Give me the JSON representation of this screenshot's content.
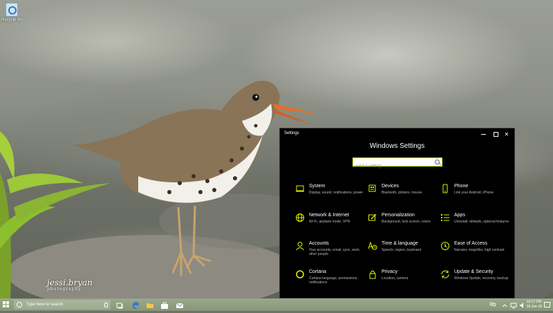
{
  "desktop": {
    "recycle_bin_label": "Recycle Bin",
    "watermark_name": "jessi.bryan",
    "watermark_sub": "photography"
  },
  "window": {
    "title": "Settings",
    "heading": "Windows Settings",
    "search_placeholder": "Find a setting",
    "accent": "#e5f500"
  },
  "tiles": [
    {
      "name": "System",
      "desc": "Display, sound, notifications, power",
      "icon": "laptop-icon"
    },
    {
      "name": "Devices",
      "desc": "Bluetooth, printers, mouse",
      "icon": "keyboard-icon"
    },
    {
      "name": "Phone",
      "desc": "Link your Android, iPhone",
      "icon": "phone-icon"
    },
    {
      "name": "Network & Internet",
      "desc": "Wi-Fi, airplane mode, VPN",
      "icon": "globe-icon"
    },
    {
      "name": "Personalization",
      "desc": "Background, lock screen, colors",
      "icon": "paintbrush-icon"
    },
    {
      "name": "Apps",
      "desc": "Uninstall, defaults, optional features",
      "icon": "apps-list-icon"
    },
    {
      "name": "Accounts",
      "desc": "Your accounts, email, sync, work, other people",
      "icon": "person-icon"
    },
    {
      "name": "Time & language",
      "desc": "Speech, region, keyboard",
      "icon": "clock-language-icon"
    },
    {
      "name": "Ease of Access",
      "desc": "Narrator, magnifier, high contrast",
      "icon": "ease-of-access-icon"
    },
    {
      "name": "Cortana",
      "desc": "Cortana language, permissions, notifications",
      "icon": "cortana-ring-icon"
    },
    {
      "name": "Privacy",
      "desc": "Location, camera",
      "icon": "lock-icon"
    },
    {
      "name": "Update & Security",
      "desc": "Windows Update, recovery, backup",
      "icon": "sync-arrows-icon"
    }
  ],
  "taskbar": {
    "search_placeholder": "Type here to search",
    "time": "10:17 PM",
    "date": "18-Jan-18"
  }
}
